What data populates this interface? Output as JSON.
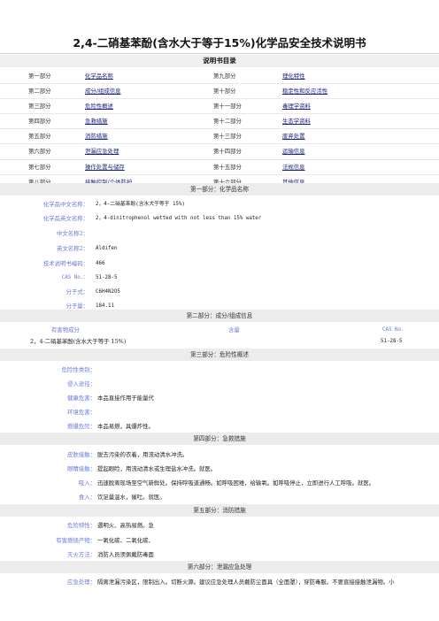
{
  "title": "2,4-二硝基苯酚(含水大于等于15%)化学品安全技术说明书",
  "toc_heading": "说明书目录",
  "toc": [
    {
      "part_left": "第一部分",
      "name_left": "化学品名称",
      "part_right": "第九部分",
      "name_right": "理化特性"
    },
    {
      "part_left": "第二部分",
      "name_left": "成分/组成信息",
      "part_right": "第十部分",
      "name_right": "稳定性和反应活性"
    },
    {
      "part_left": "第三部分",
      "name_left": "危险性概述",
      "part_right": "第十一部分",
      "name_right": "毒理学资料"
    },
    {
      "part_left": "第四部分",
      "name_left": "急救措施",
      "part_right": "第十二部分",
      "name_right": "生态学资料"
    },
    {
      "part_left": "第五部分",
      "name_left": "消防措施",
      "part_right": "第十三部分",
      "name_right": "废弃处置"
    },
    {
      "part_left": "第六部分",
      "name_left": "泄漏应急处理",
      "part_right": "第十四部分",
      "name_right": "运输信息"
    },
    {
      "part_left": "第七部分",
      "name_left": "操作处置与储存",
      "part_right": "第十五部分",
      "name_right": "法规信息"
    },
    {
      "part_left": "第八部分",
      "name_left": "接触控制/个体防护",
      "part_right": "第十六部分",
      "name_right": "其他信息"
    }
  ],
  "sec1": {
    "heading": "第一部分：化学品名称",
    "rows": [
      {
        "label": "化学品中文名称：",
        "value": "2，4-二硝基苯酚(含水大于等于 15%)"
      },
      {
        "label": "化学品英文名称：",
        "value": "2，4-dinitrophenol wetted with not less than 15% water"
      },
      {
        "label": "中文名称2：",
        "value": ""
      },
      {
        "label": "英文名称2：",
        "value": "Aldifen"
      },
      {
        "label": "技术说明书编码：",
        "value": "466"
      },
      {
        "label": "CAS No.：",
        "value": "51-28-5"
      },
      {
        "label": "分子式：",
        "value": "C6H4N2O5"
      },
      {
        "label": "分子量：",
        "value": "184.11"
      }
    ]
  },
  "sec2": {
    "heading": "第二部分：成分/组成信息",
    "col_substance": "有害物成分",
    "col_content": "含量",
    "col_cas": "CAS No.",
    "substance": "2，4-二硝基苯酚(含水大于等于 15%)",
    "cas": "51-28-5"
  },
  "sec3": {
    "heading": "第三部分：危险性概述",
    "rows": [
      {
        "label": "危险性类别：",
        "value": ""
      },
      {
        "label": "侵入途径：",
        "value": ""
      },
      {
        "label": "健康危害：",
        "value": "本品直接作用于能量代"
      },
      {
        "label": "环境危害：",
        "value": ""
      },
      {
        "label": "燃爆危险：",
        "value": "本品易燃，具爆炸性。"
      }
    ]
  },
  "sec4": {
    "heading": "第四部分：急救措施",
    "rows": [
      {
        "label": "皮肤接触：",
        "value": "脱去污染的衣着，用流动清水冲洗。"
      },
      {
        "label": "眼睛接触：",
        "value": "提起眼睑，用流动清水或生理盐水冲洗。就医。"
      },
      {
        "label": "吸入：",
        "value": "迅速脱离现场至空气新鲜处。保持呼吸道通畅。如呼吸困难，给输氧。如呼吸停止，立即进行人工呼吸。就医。"
      },
      {
        "label": "食入：",
        "value": "饮足量温水，催吐。就医。"
      }
    ]
  },
  "sec5": {
    "heading": "第五部分：消防措施",
    "rows": [
      {
        "label": "危险特性：",
        "value": "遇明火、高热易燃。急"
      },
      {
        "label": "有害燃烧产物：",
        "value": "一氧化碳、二氧化碳、"
      },
      {
        "label": "灭火方法：",
        "value": "消防人员须佩戴防毒面"
      }
    ]
  },
  "sec6": {
    "heading": "第六部分：泄漏应急处理",
    "rows": [
      {
        "label": "应急处理：",
        "value": "隔离泄漏污染区，限制出入。切断火源。建议应急处理人员戴防尘面具（全面罩），穿防毒服。不要直接接触泄漏物。小"
      }
    ]
  }
}
